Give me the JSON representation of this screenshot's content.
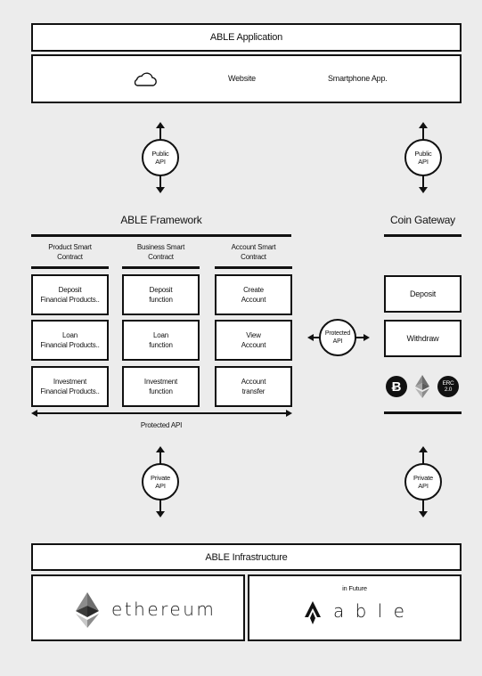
{
  "application": {
    "title": "ABLE Application",
    "items": [
      {
        "icon": "cloud-icon"
      },
      {
        "label": "Website"
      },
      {
        "label": "Smartphone App."
      }
    ]
  },
  "connectors": {
    "public_api_left": {
      "line1": "Public",
      "line2": "API"
    },
    "public_api_right": {
      "line1": "Public",
      "line2": "API"
    },
    "protected_api_mid": {
      "line1": "Protected",
      "line2": "API"
    },
    "private_api_left": {
      "line1": "Private",
      "line2": "API"
    },
    "private_api_right": {
      "line1": "Private",
      "line2": "API"
    }
  },
  "framework": {
    "title": "ABLE Framework",
    "columns": [
      {
        "header_line1": "Product Smart",
        "header_line2": "Contract",
        "cells": [
          {
            "line1": "Deposit",
            "line2": "Financial Products.."
          },
          {
            "line1": "Loan",
            "line2": "Financial Products.."
          },
          {
            "line1": "Investment",
            "line2": "Financial Products.."
          }
        ]
      },
      {
        "header_line1": "Business Smart",
        "header_line2": "Contract",
        "cells": [
          {
            "line1": "Deposit",
            "line2": "function"
          },
          {
            "line1": "Loan",
            "line2": "function"
          },
          {
            "line1": "Investment",
            "line2": "function"
          }
        ]
      },
      {
        "header_line1": "Account Smart",
        "header_line2": "Contract",
        "cells": [
          {
            "line1": "Create",
            "line2": "Account"
          },
          {
            "line1": "View",
            "line2": "Account"
          },
          {
            "line1": "Account",
            "line2": "transfer"
          }
        ]
      }
    ],
    "bottom_label": "Protected API"
  },
  "coin_gateway": {
    "title": "Coin Gateway",
    "buttons": [
      "Deposit",
      "Withdraw"
    ],
    "coins": [
      {
        "icon": "bitcoin-icon",
        "symbol": "Ƀ"
      },
      {
        "icon": "ethereum-icon"
      },
      {
        "icon": "erc20-icon",
        "line1": "ERC",
        "line2": "2.0"
      }
    ]
  },
  "infrastructure": {
    "title": "ABLE Infrastructure",
    "left": {
      "logo_text": "ethereum"
    },
    "right": {
      "note": "in Future",
      "logo_text": "a b l e"
    }
  },
  "colors": {
    "background": "#ececec",
    "stroke": "#111111",
    "box_fill": "#ffffff",
    "eth_dark": "#3c3c3b",
    "eth_mid": "#8c8c8c",
    "eth_light": "#c8c8c8"
  }
}
